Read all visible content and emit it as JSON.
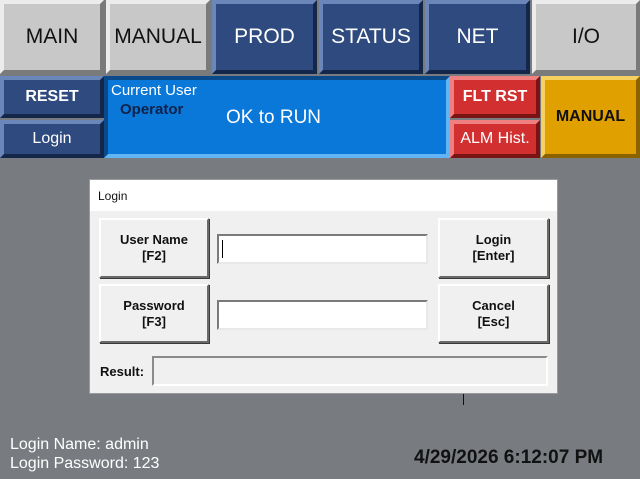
{
  "nav": {
    "main": "MAIN",
    "manual": "MANUAL",
    "prod": "PROD",
    "status": "STATUS",
    "net": "NET",
    "io": "I/O"
  },
  "controls": {
    "reset": "RESET",
    "login": "Login",
    "flt_rst": "FLT RST",
    "alm_hist": "ALM Hist.",
    "manual_mode": "MANUAL"
  },
  "status": {
    "current_user_label": "Current User",
    "current_user": "Operator",
    "run_state": "OK to RUN"
  },
  "dialog": {
    "title": "Login",
    "username_btn_line1": "User Name",
    "username_btn_line2": "[F2]",
    "password_btn_line1": "Password",
    "password_btn_line2": "[F3]",
    "login_btn_line1": "Login",
    "login_btn_line2": "[Enter]",
    "cancel_btn_line1": "Cancel",
    "cancel_btn_line2": "[Esc]",
    "username_value": "",
    "password_value": "",
    "result_label": "Result:",
    "result_value": ""
  },
  "footer": {
    "login_name": "Login Name: admin",
    "login_password": "Login Password: 123",
    "datetime": "4/29/2026 6:12:07 PM"
  },
  "colors": {
    "background": "#787c80",
    "nav_blue": "#2e4a7e",
    "status_blue": "#0a78d8",
    "fault_red": "#d23030",
    "manual_amber": "#e0a000"
  }
}
